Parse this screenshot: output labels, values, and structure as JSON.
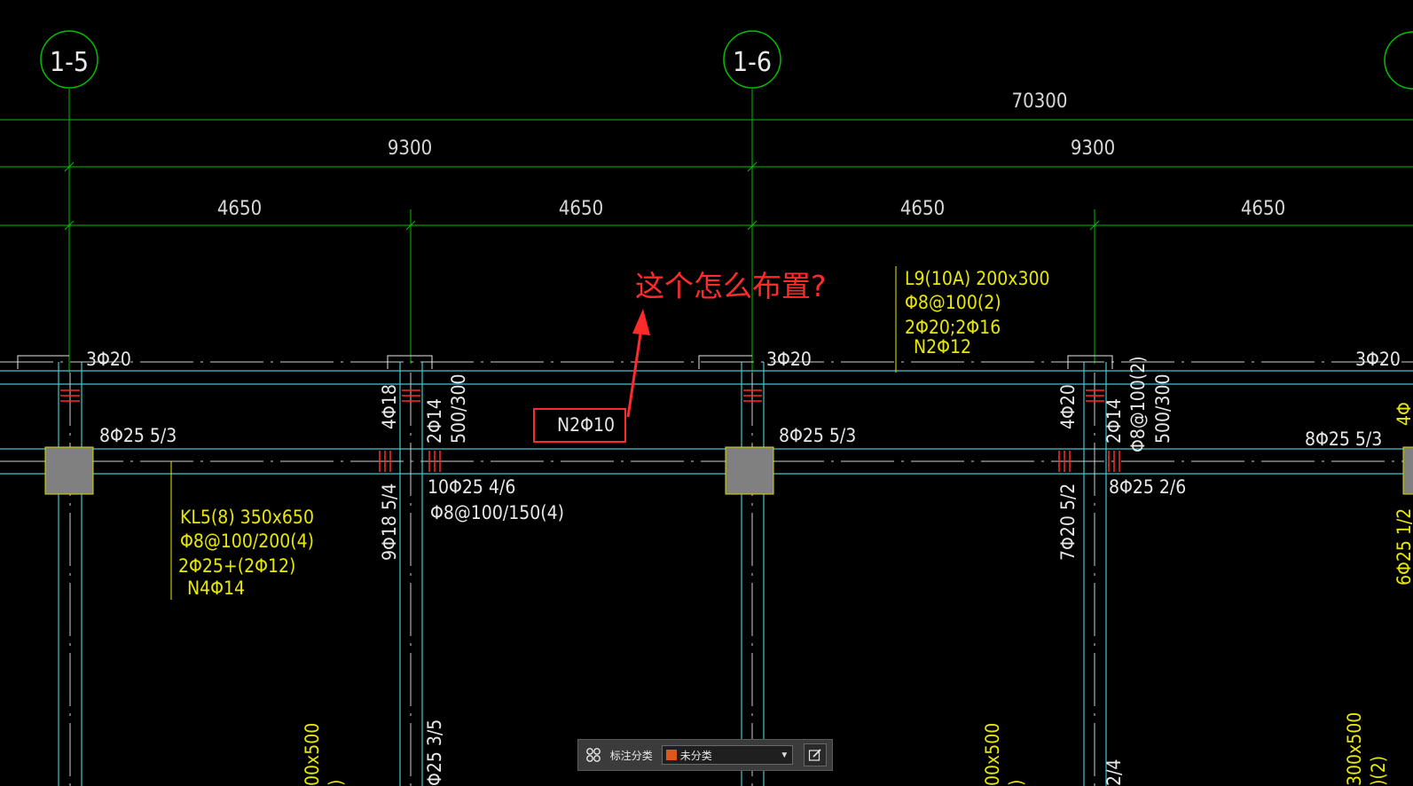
{
  "colors": {
    "background": "#000000",
    "grid_line": "#00c000",
    "dim_text": "#d8d8d8",
    "beam_line": "#3fc8d0",
    "beam_text_white": "#e8e8e8",
    "beam_text_yellow": "#e8e800",
    "column_fill": "#808080",
    "column_border": "#d8d800",
    "rebar_red": "#ff2a2a",
    "annotation_red": "#ff2a2a"
  },
  "grid_axes": {
    "axis_1_5": "1-5",
    "axis_1_6": "1-6"
  },
  "dimensions": {
    "total": "70300",
    "row2_left": "9300",
    "row2_right": "9300",
    "row3_1": "4650",
    "row3_2": "4650",
    "row3_3": "4650",
    "row3_4": "4650"
  },
  "annotation": {
    "question": "这个怎么布置?",
    "boxed_label": "N2Φ10"
  },
  "beam_labels": {
    "top_left": "3Φ20",
    "top_mid": "3Φ20",
    "top_right": "3Φ20",
    "bot_a": "8Φ25 5/3",
    "bot_b": "8Φ25 5/3",
    "bot_c": "8Φ25 5/3",
    "span_bottom_1": "10Φ25 4/6",
    "span_stirrup_1": "Φ8@100/150(4)",
    "span_bottom_2": "8Φ25 2/6",
    "vert_4_18": "4Φ18",
    "vert_2_14a": "2Φ14",
    "vert_500_300a": "500/300",
    "vert_4_20": "4Φ20",
    "vert_2_14b": "2Φ14",
    "vert_stir_b": "Φ8@100(2)",
    "vert_500_300b": "500/300",
    "vert_9_18": "9Φ18 5/4",
    "vert_7_20": "7Φ20 5/2",
    "vert_25_35": "Φ25 3/5",
    "vert_00x500_a": "00x500",
    "vert_00x500_b": "00x500",
    "vert_24": "2/4",
    "vert_300x500": "300x500",
    "vert_2_r": ")(2)",
    "vert_a_paren": ")",
    "vert_b_paren": ")",
    "vert_right_edge_1": "4Φ",
    "vert_right_edge_2": "6Φ25 1/2"
  },
  "kl5": {
    "line1": "KL5(8) 350x650",
    "line2": "Φ8@100/200(4)",
    "line3": "2Φ25+(2Φ12)",
    "line4": "N4Φ14"
  },
  "l9": {
    "line1": "L9(10A) 200x300",
    "line2": "Φ8@100(2)",
    "line3": "2Φ20;2Φ16",
    "line4": "N2Φ12"
  },
  "toolbar": {
    "label": "标注分类",
    "selected": "未分类",
    "selected_color": "#e0561c"
  }
}
